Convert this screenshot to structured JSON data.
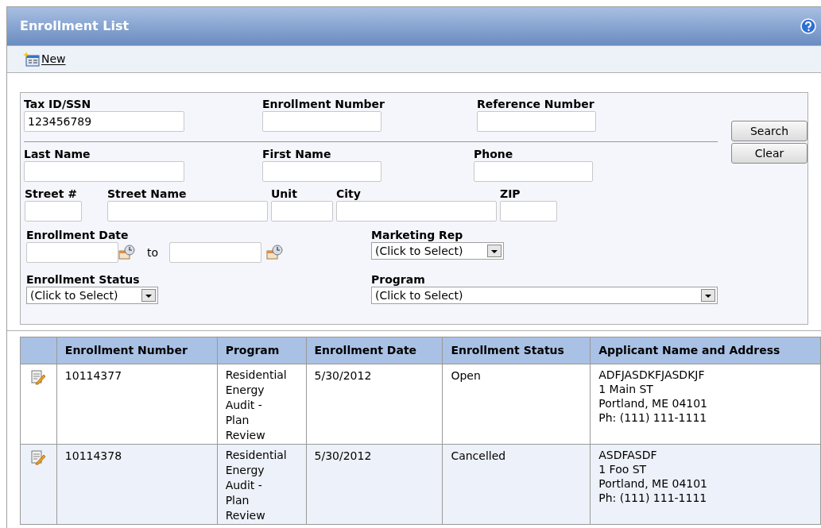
{
  "window": {
    "title": "Enrollment List"
  },
  "toolbar": {
    "new_label": "New"
  },
  "search_form": {
    "row1": [
      {
        "label": "Tax ID/SSN",
        "value": "123456789"
      },
      {
        "label": "Enrollment Number"
      },
      {
        "label": "Reference Number"
      }
    ],
    "row2": [
      {
        "label": "Last Name"
      },
      {
        "label": "First Name"
      },
      {
        "label": "Phone"
      }
    ],
    "address": [
      {
        "label": "Street #"
      },
      {
        "label": "Street Name"
      },
      {
        "label": "Unit"
      },
      {
        "label": "City"
      },
      {
        "label": "ZIP"
      }
    ],
    "enrollment_date": {
      "label": "Enrollment Date",
      "separator": "to"
    },
    "marketing_rep": {
      "label": "Marketing Rep",
      "value": "(Click to Select)"
    },
    "enrollment_status": {
      "label": "Enrollment Status",
      "value": "(Click to Select)"
    },
    "program": {
      "label": "Program",
      "value": "(Click to Select)"
    },
    "buttons": [
      "Search",
      "Clear"
    ]
  },
  "table": {
    "columns": [
      "Enrollment Number",
      "Program",
      "Enrollment Date",
      "Enrollment Status",
      "Applicant Name and Address"
    ],
    "rows": [
      {
        "number": "10114377",
        "program": "Residential Energy Audit - Plan Review",
        "date": "5/30/2012",
        "status": "Open",
        "applicant": [
          "ADFJASDKFJASDKJF",
          "1 Main ST",
          "Portland, ME 04101",
          "Ph: (111) 111-1111"
        ]
      },
      {
        "number": "10114378",
        "program": "Residential Energy Audit - Plan Review",
        "date": "5/30/2012",
        "status": "Cancelled",
        "applicant": [
          "ASDFASDF",
          "1 Foo ST",
          "Portland, ME 04101",
          "Ph: (111) 111-1111"
        ]
      }
    ]
  }
}
